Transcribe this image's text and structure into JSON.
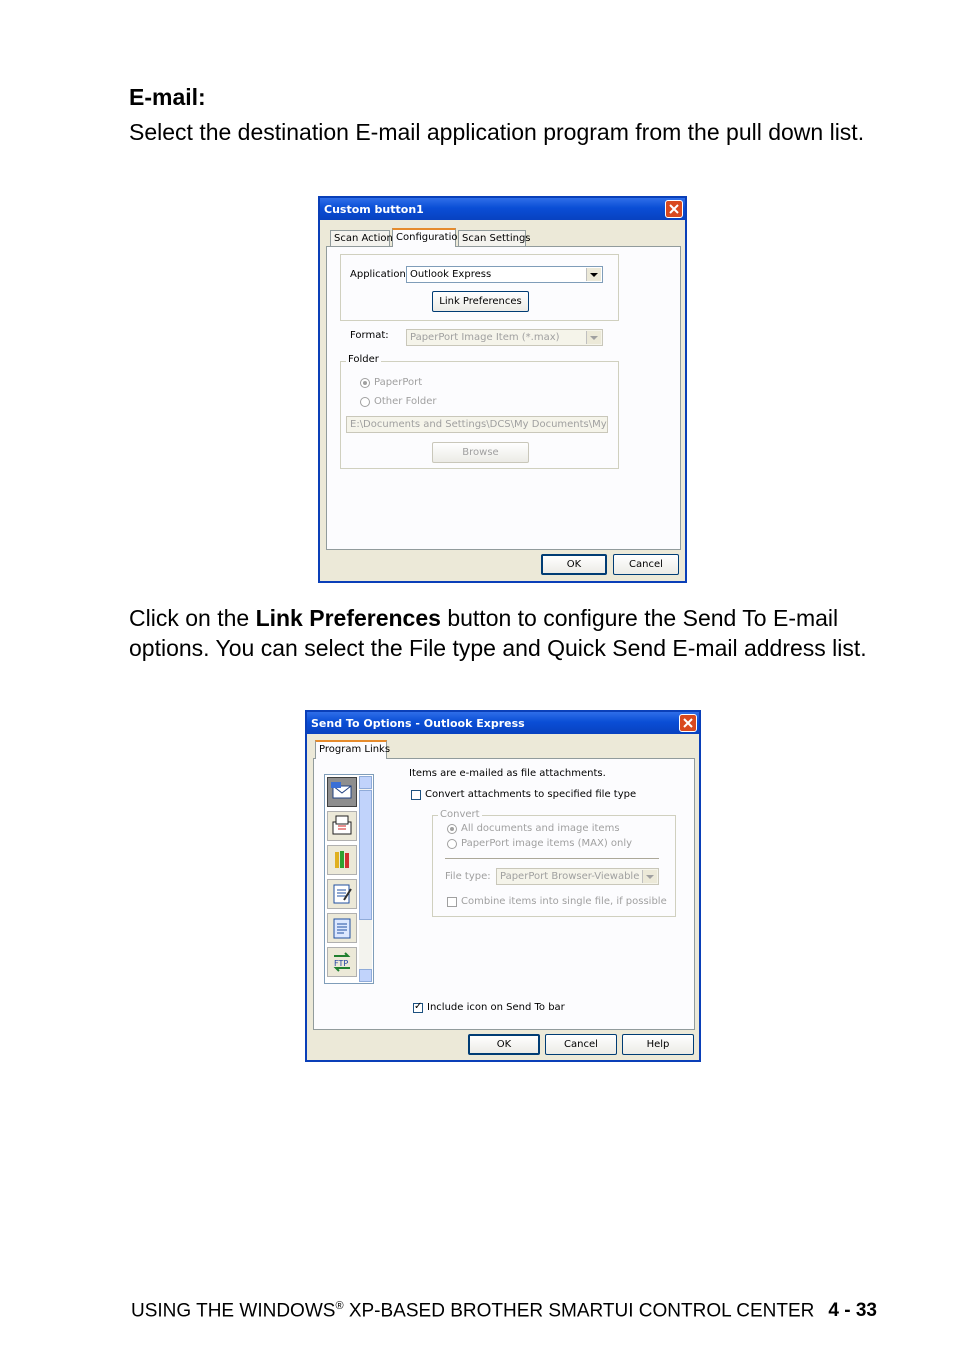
{
  "heading": "E-mail:",
  "para1": "Select the destination E-mail application program from the pull down list.",
  "para2": {
    "before": "Click on the ",
    "bold": "Link Preferences",
    "after": " button to configure the Send To E-mail options. You can select the File type and Quick Send E-mail address list."
  },
  "footer": {
    "text_before": "USING THE WINDOWS",
    "reg": "®",
    "text_after": " XP-BASED BROTHER SMARTUI CONTROL CENTER",
    "page": "4 - 33"
  },
  "dialog1": {
    "title": "Custom button1",
    "tabs": [
      "Scan Action",
      "Configuration",
      "Scan Settings"
    ],
    "application_label": "Application:",
    "application_value": "Outlook Express",
    "link_prefs_label": "Link Preferences",
    "format_label": "Format:",
    "format_value": "PaperPort Image Item (*.max)",
    "folder_label": "Folder",
    "radio_paperport": "PaperPort",
    "radio_other": "Other Folder",
    "folder_path": "E:\\Documents and Settings\\DCS\\My Documents\\My Paper",
    "browse_label": "Browse",
    "ok_label": "OK",
    "cancel_label": "Cancel"
  },
  "dialog2": {
    "title": "Send To Options - Outlook Express",
    "tab": "Program Links",
    "info": "Items are e-mailed as file attachments.",
    "convert_check": "Convert attachments to specified file type",
    "convert_group": "Convert",
    "radio_all": "All documents and image items",
    "radio_pp": "PaperPort image items (MAX) only",
    "filetype_label": "File type:",
    "filetype_value": "PaperPort Browser-Viewable (*.htr",
    "combine_check": "Combine items into single file, if possible",
    "include_check": "Include icon on Send To bar",
    "ok_label": "OK",
    "cancel_label": "Cancel",
    "help_label": "Help",
    "icons": [
      "email-icon",
      "fax-icon",
      "paint-icon",
      "notepad-icon",
      "document-icon",
      "ftp-icon"
    ],
    "ftp_text": "FTP"
  },
  "colors": {
    "title_blue": "#0a4ed6",
    "dialog_bg": "#ece9d8",
    "close_red": "#d9491f",
    "tab_highlight": "#e68b2c"
  }
}
